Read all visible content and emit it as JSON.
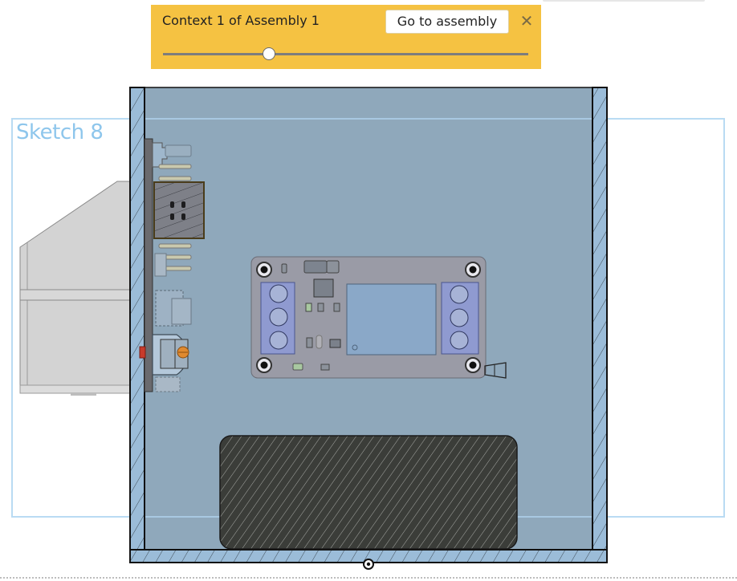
{
  "banner": {
    "title": "Context 1 of Assembly 1",
    "goto_label": "Go to assembly",
    "close_icon": "close-icon",
    "slider_value_fraction": 0.29,
    "background_color": "#f5c242"
  },
  "sketch": {
    "label": "Sketch 8",
    "color": "#8ec6ec"
  },
  "viewport": {
    "enclosure_fill": "#8fa8bb",
    "wall_fill": "#9bbcd8",
    "battery_fill": "#3b3d39",
    "pcb_fill": "#9a9ba6",
    "terminal_fill": "#8f9ad0",
    "relay_fill": "#8aa8c8",
    "origin_icon": "origin-point-icon"
  }
}
